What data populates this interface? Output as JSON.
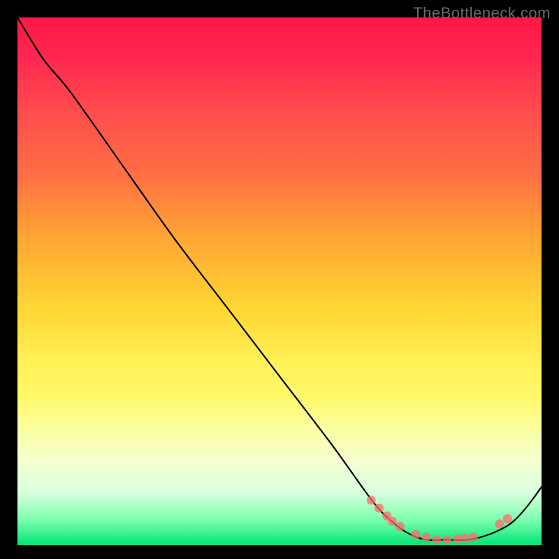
{
  "watermark": "TheBottleneck.com",
  "chart_data": {
    "type": "line",
    "title": "",
    "xlabel": "",
    "ylabel": "",
    "x": [
      0.0,
      0.05,
      0.1,
      0.2,
      0.3,
      0.4,
      0.5,
      0.6,
      0.68,
      0.72,
      0.75,
      0.78,
      0.82,
      0.86,
      0.9,
      0.94,
      0.97,
      1.0
    ],
    "values": [
      1.0,
      0.92,
      0.86,
      0.72,
      0.58,
      0.45,
      0.32,
      0.19,
      0.08,
      0.04,
      0.02,
      0.01,
      0.01,
      0.01,
      0.02,
      0.04,
      0.07,
      0.11
    ],
    "markers": {
      "x": [
        0.675,
        0.69,
        0.705,
        0.715,
        0.73,
        0.76,
        0.78,
        0.8,
        0.82,
        0.84,
        0.855,
        0.87,
        0.92,
        0.935
      ],
      "y": [
        0.085,
        0.07,
        0.055,
        0.045,
        0.035,
        0.02,
        0.015,
        0.01,
        0.01,
        0.012,
        0.013,
        0.015,
        0.04,
        0.05
      ]
    },
    "xlim": [
      0,
      1
    ],
    "ylim": [
      0,
      1
    ]
  }
}
